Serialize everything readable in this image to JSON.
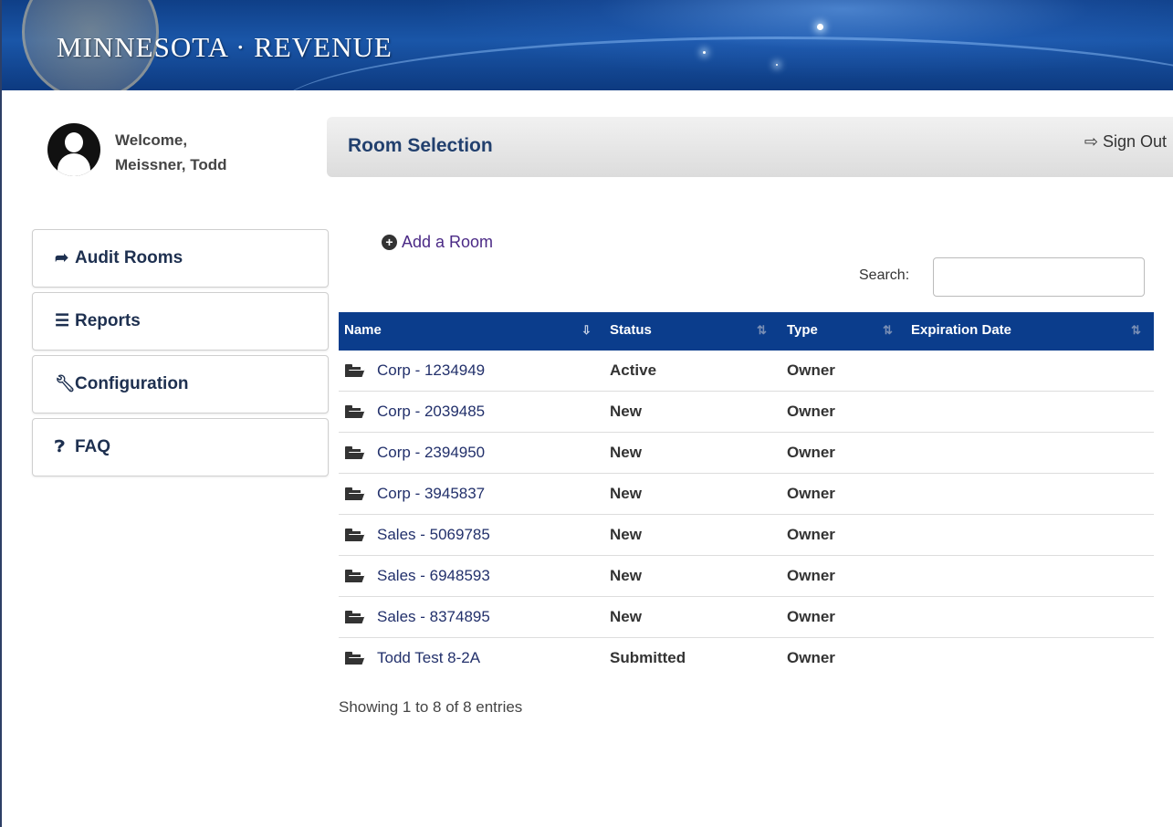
{
  "header": {
    "brand": "MINNESOTA · REVENUE"
  },
  "user": {
    "welcome_line": "Welcome,",
    "name": "Meissner, Todd"
  },
  "sidebar": {
    "items": [
      {
        "label": "Audit Rooms",
        "icon": "share-arrow-icon"
      },
      {
        "label": "Reports",
        "icon": "list-icon"
      },
      {
        "label": "Configuration",
        "icon": "wrench-icon"
      },
      {
        "label": "FAQ",
        "icon": "question-circle-icon"
      }
    ]
  },
  "page": {
    "title": "Room Selection",
    "sign_out": "Sign Out"
  },
  "actions": {
    "add_room": "Add a Room"
  },
  "search": {
    "label": "Search:",
    "value": ""
  },
  "table": {
    "columns": [
      "Name",
      "Status",
      "Type",
      "Expiration Date"
    ],
    "rows": [
      {
        "name": "Corp - 1234949",
        "status": "Active",
        "type": "Owner",
        "expiration": ""
      },
      {
        "name": "Corp - 2039485",
        "status": "New",
        "type": "Owner",
        "expiration": ""
      },
      {
        "name": "Corp - 2394950",
        "status": "New",
        "type": "Owner",
        "expiration": ""
      },
      {
        "name": "Corp - 3945837",
        "status": "New",
        "type": "Owner",
        "expiration": ""
      },
      {
        "name": "Sales - 5069785",
        "status": "New",
        "type": "Owner",
        "expiration": ""
      },
      {
        "name": "Sales - 6948593",
        "status": "New",
        "type": "Owner",
        "expiration": ""
      },
      {
        "name": "Sales - 8374895",
        "status": "New",
        "type": "Owner",
        "expiration": ""
      },
      {
        "name": "Todd Test 8-2A",
        "status": "Submitted",
        "type": "Owner",
        "expiration": ""
      }
    ],
    "info": "Showing 1 to 8 of 8 entries"
  },
  "colors": {
    "header_blue": "#0f3f87",
    "table_header": "#0b3d8c",
    "title_blue": "#22406e",
    "link_purple": "#4b2a86"
  }
}
